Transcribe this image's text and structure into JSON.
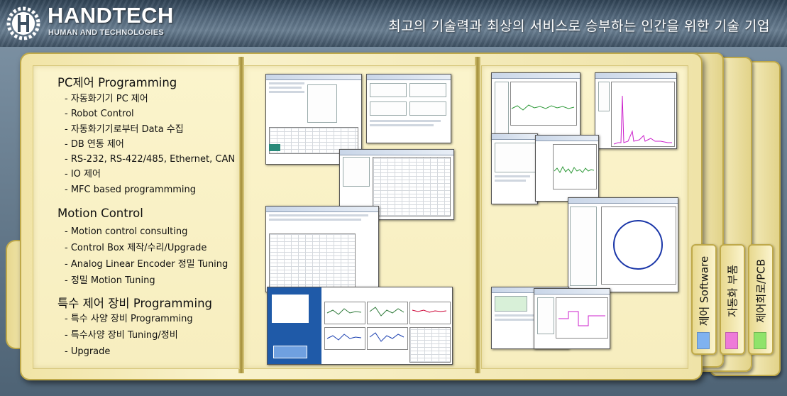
{
  "header": {
    "brand": "HANDTECH",
    "tagline": "HUMAN AND TECHNOLOGIES",
    "slogan": "최고의 기술력과 최상의 서비스로 승부하는 인간을 위한 기술 기업"
  },
  "sections": [
    {
      "title": "PC제어 Programming",
      "items": [
        "- 자동화기기 PC 제어",
        "- Robot Control",
        "- 자동화기기로부터 Data 수집",
        "- DB 연동 제어",
        "- RS-232, RS-422/485, Ethernet, CAN",
        "- IO 제어",
        "- MFC based programmming"
      ]
    },
    {
      "title": "Motion Control",
      "items": [
        "- Motion control consulting",
        "- Control Box 제작/수리/Upgrade",
        "- Analog Linear Encoder 정밀 Tuning",
        "- 정밀 Motion Tuning"
      ]
    },
    {
      "title": "특수 제어 장비 Programming",
      "items": [
        "- 특수 사양 장비 Programming",
        "- 특수사양 장비 Tuning/정비",
        "- Upgrade"
      ]
    }
  ],
  "tabs": [
    {
      "label": "제어 Software",
      "color": "#7fb2f0"
    },
    {
      "label": "자동화 부품",
      "color": "#ee7ad8"
    },
    {
      "label": "제어회로/PCB",
      "color": "#8fe36a"
    }
  ]
}
